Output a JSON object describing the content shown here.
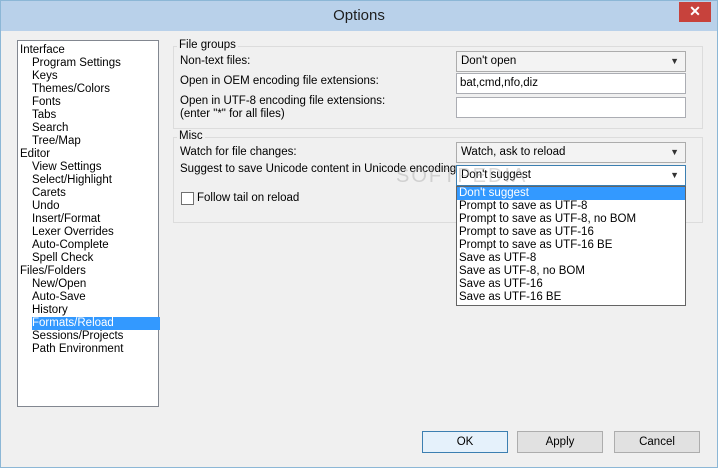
{
  "window": {
    "title": "Options",
    "close_glyph": "✕"
  },
  "tree": {
    "items": [
      "Interface",
      "Program Settings",
      "Keys",
      "Themes/Colors",
      "Fonts",
      "Tabs",
      "Search",
      "Tree/Map",
      "Editor",
      "View Settings",
      "Select/Highlight",
      "Carets",
      "Undo",
      "Insert/Format",
      "Lexer Overrides",
      "Auto-Complete",
      "Spell Check",
      "Files/Folders",
      "New/Open",
      "Auto-Save",
      "History",
      "Formats/Reload",
      "Sessions/Projects",
      "Path Environment"
    ],
    "selected": "Formats/Reload"
  },
  "file_groups": {
    "title": "File groups",
    "nontext_label": "Non-text files:",
    "nontext_value": "Don't open",
    "oem_label": "Open in OEM encoding file extensions:",
    "oem_value": "bat,cmd,nfo,diz",
    "utf8_label_line1": "Open in UTF-8 encoding file extensions:",
    "utf8_label_line2": "(enter \"*\" for all files)",
    "utf8_value": ""
  },
  "misc": {
    "title": "Misc",
    "watch_label": "Watch for file changes:",
    "watch_value": "Watch, ask to reload",
    "suggest_label": "Suggest to save Unicode content in Unicode encoding:",
    "suggest_value": "Don't suggest",
    "follow_tail_label": "Follow tail on reload",
    "follow_tail_checked": false
  },
  "dropdown": {
    "options": [
      "Don't suggest",
      "Prompt to save as UTF-8",
      "Prompt to save as UTF-8, no BOM",
      "Prompt to save as UTF-16",
      "Prompt to save as UTF-16 BE",
      "Save as UTF-8",
      "Save as UTF-8, no BOM",
      "Save as UTF-16",
      "Save as UTF-16 BE"
    ],
    "selected": "Don't suggest"
  },
  "buttons": {
    "ok": "OK",
    "apply": "Apply",
    "cancel": "Cancel"
  },
  "watermark": "SOFTPEDIA",
  "colors": {
    "selection": "#3399ff",
    "titlebar": "#b9d1ea",
    "close": "#c7423c"
  }
}
